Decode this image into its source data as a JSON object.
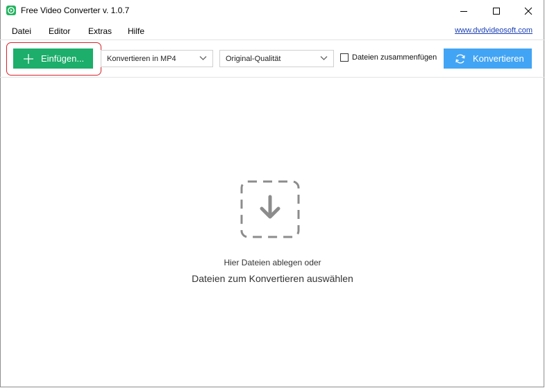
{
  "window": {
    "title": "Free Video Converter v. 1.0.7",
    "controls": [
      "minimize-icon",
      "maximize-icon",
      "close-icon"
    ]
  },
  "menu": {
    "items": [
      "Datei",
      "Editor",
      "Extras",
      "Hilfe"
    ],
    "link": "www.dvdvideosoft.com"
  },
  "toolbar": {
    "add_label": "Einfügen...",
    "format_select": "Konvertieren in MP4",
    "quality_select": "Original-Qualität",
    "merge_label": "Dateien zusammenfügen",
    "merge_checked": false,
    "convert_label": "Konvertieren"
  },
  "dropzone": {
    "line1": "Hier Dateien ablegen oder",
    "line2": "Dateien zum Konvertieren auswählen",
    "icon": "download-arrow-icon"
  },
  "colors": {
    "add_button": "#1cae6a",
    "convert_button": "#42a4f4",
    "highlight": "#d6242b",
    "link": "#1a3fb5"
  }
}
